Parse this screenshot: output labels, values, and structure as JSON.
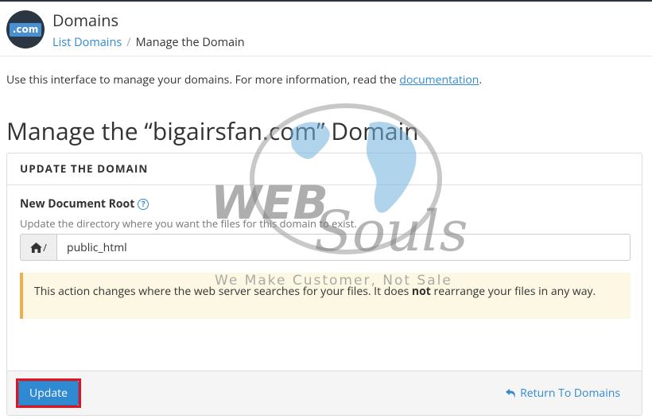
{
  "header": {
    "app_icon_text": ".com",
    "title": "Domains",
    "breadcrumb": {
      "link": "List Domains",
      "separator": "/",
      "current": "Manage the Domain"
    }
  },
  "intro": {
    "text": "Use this interface to manage your domains. For more information, read the ",
    "link": "documentation",
    "end": "."
  },
  "page_title": "Manage the “bigairsfan.com” Domain",
  "panel": {
    "heading": "UPDATE THE DOMAIN",
    "field_label": "New Document Root",
    "help_glyph": "?",
    "field_help": "Update the directory where you want the files for this domain to exist.",
    "input_prefix": "/",
    "input_value": "public_html",
    "alert": {
      "before": "This action changes where the web server searches for your files. It does ",
      "bold": "not",
      "after": " rearrange your files in any way."
    },
    "update_label": "Update",
    "return_label": "Return To Domains"
  },
  "watermark": {
    "brand_left": "WEB",
    "brand_right": "Souls",
    "tagline": "We Make Customer, Not Sale"
  },
  "colors": {
    "link": "#2f8ad2",
    "primary_button": "#2f8ad2",
    "highlight": "#e0141e",
    "alert_bg": "#fcf8e3",
    "alert_border": "#f0ad4e"
  },
  "icons": {
    "home": "home-icon",
    "help": "question-circle-icon",
    "return": "undo-arrow-icon"
  }
}
